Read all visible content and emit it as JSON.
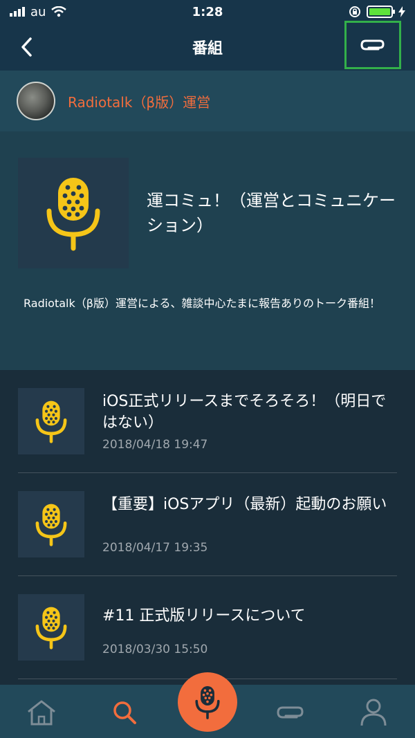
{
  "status_bar": {
    "carrier": "au",
    "time": "1:28"
  },
  "nav": {
    "title": "番組"
  },
  "owner": {
    "name": "Radiotalk（β版）運営"
  },
  "program": {
    "title": "運コミュ！（運営とコミュニケーション）",
    "description": "Radiotalk（β版）運営による、雑談中心たまに報告ありのトーク番組！"
  },
  "episodes": [
    {
      "title": "iOS正式リリースまでそろそろ！（明日ではない）",
      "date": "2018/04/18 19:47"
    },
    {
      "title": "【重要】iOSアプリ（最新）起動のお願い",
      "date": "2018/04/17 19:35"
    },
    {
      "title": "#11 正式版リリースについて",
      "date": "2018/03/30 15:50"
    }
  ],
  "tabs": [
    {
      "icon": "home-icon"
    },
    {
      "icon": "search-icon",
      "active": true
    },
    {
      "icon": "microphone-icon"
    },
    {
      "icon": "clip-icon"
    },
    {
      "icon": "profile-icon"
    }
  ],
  "colors": {
    "accent": "#f26d3d",
    "mic_yellow": "#f5c518",
    "highlight_box": "#33b04a",
    "tab_inactive": "#7e8d97"
  }
}
